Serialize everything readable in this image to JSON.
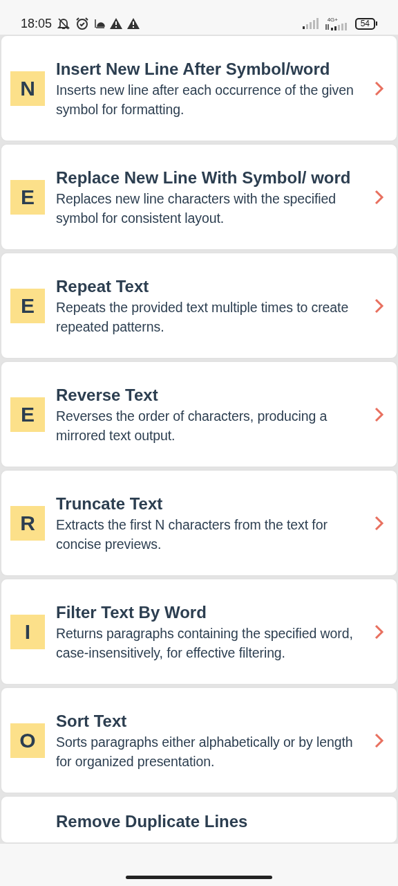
{
  "status_bar": {
    "time": "18:05",
    "network": "4G+",
    "battery": "54"
  },
  "tools": [
    {
      "letter": "N",
      "title": "Insert New Line After Symbol/word",
      "description": "Inserts new line after each occurrence of the given symbol for formatting."
    },
    {
      "letter": "E",
      "title": "Replace New Line With Symbol/ word",
      "description": "Replaces new line characters with the specified symbol for consistent layout."
    },
    {
      "letter": "E",
      "title": "Repeat Text",
      "description": "Repeats the provided text multiple times to create repeated patterns."
    },
    {
      "letter": "E",
      "title": "Reverse Text",
      "description": "Reverses the order of characters, producing a mirrored text output."
    },
    {
      "letter": "R",
      "title": "Truncate Text",
      "description": "Extracts the first N characters from the text for concise previews."
    },
    {
      "letter": "I",
      "title": "Filter Text By Word",
      "description": "Returns paragraphs containing the specified word, case-insensitively, for effective filtering."
    },
    {
      "letter": "O",
      "title": "Sort Text",
      "description": "Sorts paragraphs either alphabetically or by length for organized presentation."
    }
  ],
  "partial_tool": {
    "title": "Remove Duplicate Lines"
  }
}
